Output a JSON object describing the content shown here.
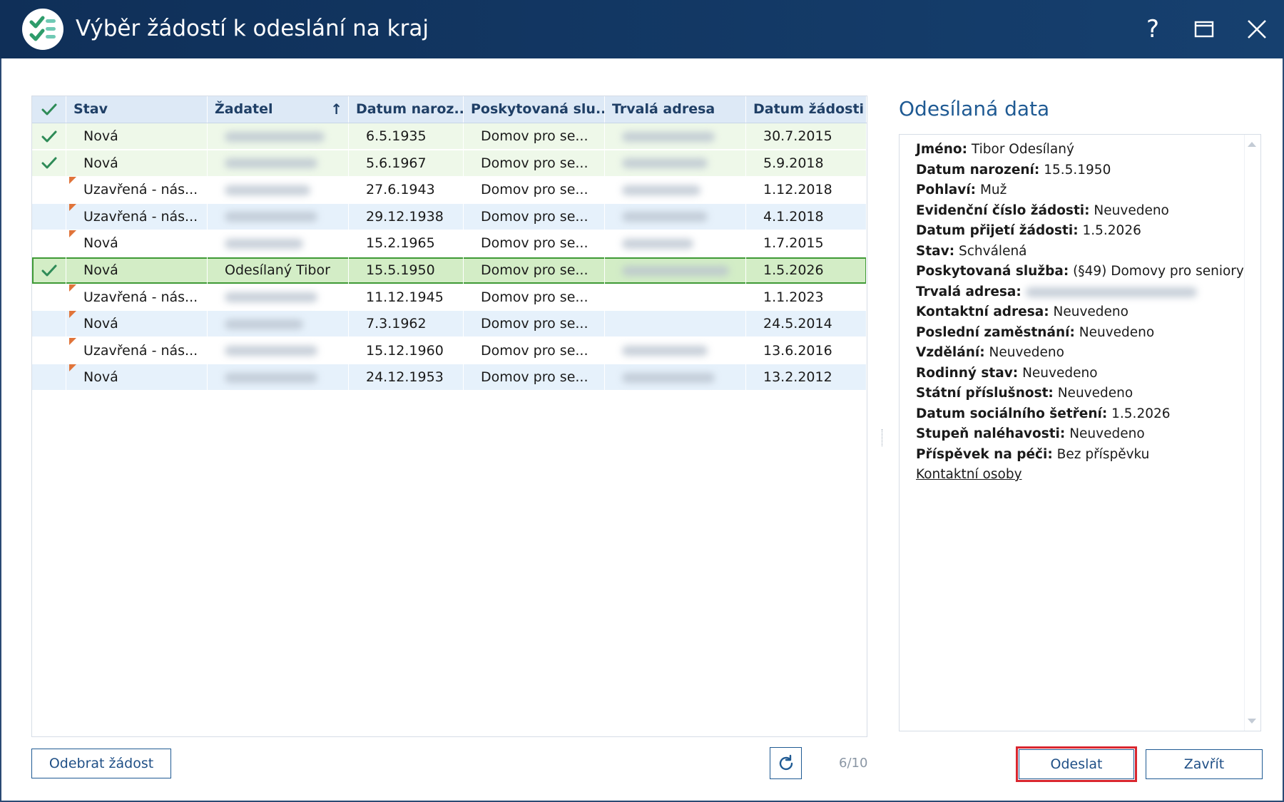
{
  "window": {
    "title": "Výběr žádostí k odeslání na kraj",
    "help_label": "?",
    "accent_color": "#16406f"
  },
  "grid": {
    "columns": [
      {
        "key": "check",
        "label": ""
      },
      {
        "key": "stav",
        "label": "Stav"
      },
      {
        "key": "zadatel",
        "label": "Žadatel",
        "sorted": "ascending"
      },
      {
        "key": "datum_narozeni",
        "label": "Datum naroz..."
      },
      {
        "key": "sluzba",
        "label": "Poskytovaná slu..."
      },
      {
        "key": "adresa",
        "label": "Trvalá adresa"
      },
      {
        "key": "datum_zadosti",
        "label": "Datum žádosti"
      }
    ],
    "rows": [
      {
        "checked": true,
        "flag": false,
        "stav": "Nová",
        "zadatel": "",
        "datum_narozeni": "6.5.1935",
        "sluzba": "Domov pro se...",
        "adresa": "",
        "datum_zadosti": "30.7.2015"
      },
      {
        "checked": true,
        "flag": false,
        "stav": "Nová",
        "zadatel": "",
        "datum_narozeni": "5.6.1967",
        "sluzba": "Domov pro se...",
        "adresa": "",
        "datum_zadosti": "5.9.2018"
      },
      {
        "checked": false,
        "flag": true,
        "stav": "Uzavřená - nás...",
        "zadatel": "",
        "datum_narozeni": "27.6.1943",
        "sluzba": "Domov pro se...",
        "adresa": "",
        "datum_zadosti": "1.12.2018"
      },
      {
        "checked": false,
        "flag": true,
        "stav": "Uzavřená - nás...",
        "zadatel": "",
        "datum_narozeni": "29.12.1938",
        "sluzba": "Domov pro se...",
        "adresa": "",
        "datum_zadosti": "4.1.2018"
      },
      {
        "checked": false,
        "flag": true,
        "stav": "Nová",
        "zadatel": "",
        "datum_narozeni": "15.2.1965",
        "sluzba": "Domov pro se...",
        "adresa": "",
        "datum_zadosti": "1.7.2015"
      },
      {
        "checked": true,
        "flag": false,
        "selected": true,
        "stav": "Nová",
        "zadatel": "Odesílaný Tibor",
        "datum_narozeni": "15.5.1950",
        "sluzba": "Domov pro se...",
        "adresa": "",
        "datum_zadosti": "1.5.2026"
      },
      {
        "checked": false,
        "flag": true,
        "stav": "Uzavřená - nás...",
        "zadatel": "",
        "datum_narozeni": "11.12.1945",
        "sluzba": "Domov pro se...",
        "adresa": "",
        "datum_zadosti": "1.1.2023"
      },
      {
        "checked": false,
        "flag": true,
        "stav": "Nová",
        "zadatel": "",
        "datum_narozeni": "7.3.1962",
        "sluzba": "Domov pro se...",
        "adresa": "",
        "datum_zadosti": "24.5.2014"
      },
      {
        "checked": false,
        "flag": true,
        "stav": "Uzavřená - nás...",
        "zadatel": "",
        "datum_narozeni": "15.12.1960",
        "sluzba": "Domov pro se...",
        "adresa": "",
        "datum_zadosti": "13.6.2016"
      },
      {
        "checked": false,
        "flag": true,
        "stav": "Nová",
        "zadatel": "",
        "datum_narozeni": "24.12.1953",
        "sluzba": "Domov pro se...",
        "adresa": "",
        "datum_zadosti": "13.2.2012"
      }
    ]
  },
  "detail": {
    "title": "Odesílaná data",
    "fields": [
      {
        "label": "Jméno:",
        "value": "Tibor Odesílaný"
      },
      {
        "label": "Datum narození:",
        "value": "15.5.1950"
      },
      {
        "label": "Pohlaví:",
        "value": "Muž"
      },
      {
        "label": "Evidenční číslo žádosti:",
        "value": "Neuvedeno"
      },
      {
        "label": "Datum přijetí žádosti:",
        "value": "1.5.2026"
      },
      {
        "label": "Stav:",
        "value": "Schválená"
      },
      {
        "label": "Poskytovaná služba:",
        "value": "(§49) Domovy pro seniory"
      },
      {
        "label": "Trvalá adresa:",
        "value": ""
      },
      {
        "label": "Kontaktní adresa:",
        "value": "Neuvedeno"
      },
      {
        "label": "Poslední zaměstnání:",
        "value": "Neuvedeno"
      },
      {
        "label": "Vzdělání:",
        "value": "Neuvedeno"
      },
      {
        "label": "Rodinný stav:",
        "value": "Neuvedeno"
      },
      {
        "label": "Státní příslušnost:",
        "value": "Neuvedeno"
      },
      {
        "label": "Datum sociálního šetření:",
        "value": "1.5.2026"
      },
      {
        "label": "Stupeň naléhavosti:",
        "value": "Neuvedeno"
      },
      {
        "label": "Příspěvek na péči:",
        "value": "Bez příspěvku"
      }
    ],
    "contact_link": "Kontaktní osoby"
  },
  "footer": {
    "remove_label": "Odebrat žádost",
    "count": "6/10",
    "send_label": "Odeslat",
    "close_label": "Zavřít"
  },
  "colors": {
    "check": "#2e8b57",
    "flag": "#e0743a",
    "highlight_border": "#d9262f",
    "selected_row": "#d3edc6"
  }
}
